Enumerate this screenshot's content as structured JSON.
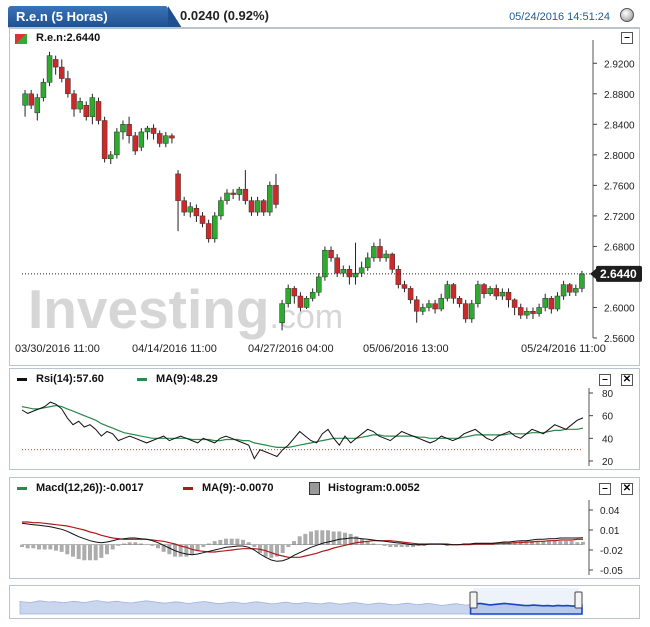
{
  "header": {
    "symbol": "R.e.n (5 Horas)",
    "change": "0.0240 (0.92%)",
    "datetime": "05/24/2016 14:51:24"
  },
  "price_panel": {
    "label": "R.e.n:2.6440",
    "last_value": "2.6440",
    "watermark": "Investing",
    "watermark_suffix": ".com"
  },
  "rsi_panel": {
    "rsi_label": "Rsi(14):57.60",
    "ma_label": "MA(9):48.29"
  },
  "macd_panel": {
    "macd_label": "Macd(12,26)):-0.0017",
    "signal_label": "MA(9):-0.0070",
    "hist_label": "Histogram:0.0052"
  },
  "colors": {
    "up": "#2eaa2e",
    "down": "#cc2a2a",
    "rsi": "#111111",
    "ma": "#2a8a4a",
    "macd_signal": "#b01818",
    "nav_fill": "#b8c9ea",
    "nav_line": "#1a44c8"
  },
  "chart_data": [
    {
      "type": "candlestick",
      "title": "R.e.n (5 Horas)",
      "ylim": [
        2.56,
        2.94
      ],
      "y_ticks": [
        "2.9200",
        "2.8800",
        "2.8400",
        "2.8000",
        "2.7600",
        "2.7200",
        "2.6800",
        "2.6400",
        "2.6000",
        "2.5600"
      ],
      "x_ticks": [
        "03/30/2016 11:00",
        "04/14/2016 11:00",
        "04/27/2016 04:00",
        "05/06/2016 13:00",
        "05/24/2016 11:00"
      ],
      "last": 2.644,
      "candles": [
        [
          2.865,
          2.88,
          2.85,
          2.885
        ],
        [
          2.88,
          2.865,
          2.86,
          2.885
        ],
        [
          2.855,
          2.875,
          2.845,
          2.88
        ],
        [
          2.875,
          2.895,
          2.87,
          2.9
        ],
        [
          2.895,
          2.93,
          2.89,
          2.935
        ],
        [
          2.925,
          2.915,
          2.905,
          2.93
        ],
        [
          2.915,
          2.9,
          2.895,
          2.925
        ],
        [
          2.9,
          2.88,
          2.875,
          2.91
        ],
        [
          2.88,
          2.86,
          2.85,
          2.885
        ],
        [
          2.86,
          2.87,
          2.855,
          2.875
        ],
        [
          2.865,
          2.85,
          2.845,
          2.87
        ],
        [
          2.85,
          2.875,
          2.84,
          2.88
        ],
        [
          2.87,
          2.845,
          2.84,
          2.875
        ],
        [
          2.845,
          2.795,
          2.79,
          2.85
        ],
        [
          2.795,
          2.8,
          2.788,
          2.805
        ],
        [
          2.8,
          2.83,
          2.795,
          2.835
        ],
        [
          2.83,
          2.84,
          2.82,
          2.845
        ],
        [
          2.84,
          2.825,
          2.815,
          2.85
        ],
        [
          2.825,
          2.805,
          2.8,
          2.83
        ],
        [
          2.81,
          2.83,
          2.805,
          2.835
        ],
        [
          2.83,
          2.835,
          2.82,
          2.838
        ],
        [
          2.835,
          2.828,
          2.82,
          2.84
        ],
        [
          2.828,
          2.815,
          2.81,
          2.832
        ],
        [
          2.815,
          2.825,
          2.81,
          2.83
        ],
        [
          2.825,
          2.822,
          2.815,
          2.828
        ],
        [
          2.775,
          2.74,
          2.7,
          2.78
        ],
        [
          2.74,
          2.725,
          2.72,
          2.745
        ],
        [
          2.725,
          2.732,
          2.718,
          2.738
        ],
        [
          2.73,
          2.72,
          2.712,
          2.735
        ],
        [
          2.72,
          2.71,
          2.705,
          2.725
        ],
        [
          2.71,
          2.69,
          2.685,
          2.715
        ],
        [
          2.69,
          2.72,
          2.685,
          2.725
        ],
        [
          2.72,
          2.74,
          2.715,
          2.745
        ],
        [
          2.74,
          2.75,
          2.735,
          2.755
        ],
        [
          2.75,
          2.748,
          2.742,
          2.755
        ],
        [
          2.748,
          2.755,
          2.74,
          2.758
        ],
        [
          2.755,
          2.74,
          2.735,
          2.78
        ],
        [
          2.74,
          2.725,
          2.72,
          2.745
        ],
        [
          2.725,
          2.74,
          2.72,
          2.745
        ],
        [
          2.74,
          2.725,
          2.72,
          2.742
        ],
        [
          2.725,
          2.76,
          2.72,
          2.765
        ],
        [
          2.76,
          2.735,
          2.73,
          2.775
        ],
        [
          2.58,
          2.605,
          2.57,
          2.61
        ],
        [
          2.605,
          2.625,
          2.6,
          2.63
        ],
        [
          2.625,
          2.615,
          2.605,
          2.628
        ],
        [
          2.615,
          2.6,
          2.595,
          2.62
        ],
        [
          2.6,
          2.612,
          2.598,
          2.615
        ],
        [
          2.612,
          2.62,
          2.608,
          2.625
        ],
        [
          2.62,
          2.64,
          2.615,
          2.645
        ],
        [
          2.64,
          2.675,
          2.635,
          2.68
        ],
        [
          2.675,
          2.665,
          2.66,
          2.68
        ],
        [
          2.665,
          2.645,
          2.64,
          2.67
        ],
        [
          2.645,
          2.65,
          2.64,
          2.655
        ],
        [
          2.65,
          2.64,
          2.63,
          2.655
        ],
        [
          2.64,
          2.645,
          2.63,
          2.685
        ],
        [
          2.645,
          2.652,
          2.64,
          2.66
        ],
        [
          2.652,
          2.665,
          2.648,
          2.672
        ],
        [
          2.665,
          2.68,
          2.66,
          2.685
        ],
        [
          2.68,
          2.665,
          2.66,
          2.69
        ],
        [
          2.665,
          2.67,
          2.66,
          2.675
        ],
        [
          2.67,
          2.65,
          2.645,
          2.672
        ],
        [
          2.65,
          2.63,
          2.625,
          2.655
        ],
        [
          2.63,
          2.625,
          2.62,
          2.635
        ],
        [
          2.625,
          2.61,
          2.605,
          2.628
        ],
        [
          2.61,
          2.595,
          2.58,
          2.615
        ],
        [
          2.595,
          2.6,
          2.59,
          2.605
        ],
        [
          2.6,
          2.605,
          2.595,
          2.61
        ],
        [
          2.605,
          2.598,
          2.592,
          2.61
        ],
        [
          2.598,
          2.612,
          2.595,
          2.618
        ],
        [
          2.612,
          2.63,
          2.608,
          2.635
        ],
        [
          2.63,
          2.612,
          2.605,
          2.632
        ],
        [
          2.612,
          2.605,
          2.6,
          2.615
        ],
        [
          2.605,
          2.585,
          2.58,
          2.61
        ],
        [
          2.585,
          2.605,
          2.58,
          2.61
        ],
        [
          2.605,
          2.63,
          2.6,
          2.635
        ],
        [
          2.63,
          2.618,
          2.612,
          2.632
        ],
        [
          2.618,
          2.625,
          2.615,
          2.628
        ],
        [
          2.625,
          2.615,
          2.61,
          2.63
        ],
        [
          2.615,
          2.62,
          2.61,
          2.625
        ],
        [
          2.62,
          2.61,
          2.6,
          2.625
        ],
        [
          2.61,
          2.6,
          2.59,
          2.612
        ],
        [
          2.6,
          2.59,
          2.585,
          2.605
        ],
        [
          2.59,
          2.595,
          2.585,
          2.6
        ],
        [
          2.595,
          2.592,
          2.585,
          2.6
        ],
        [
          2.592,
          2.6,
          2.588,
          2.605
        ],
        [
          2.6,
          2.612,
          2.595,
          2.618
        ],
        [
          2.612,
          2.598,
          2.592,
          2.615
        ],
        [
          2.598,
          2.615,
          2.595,
          2.62
        ],
        [
          2.615,
          2.63,
          2.61,
          2.635
        ],
        [
          2.63,
          2.62,
          2.615,
          2.632
        ],
        [
          2.62,
          2.625,
          2.615,
          2.63
        ],
        [
          2.625,
          2.644,
          2.62,
          2.648
        ]
      ]
    },
    {
      "type": "line",
      "ylim": [
        20,
        80
      ],
      "y_ticks": [
        "80",
        "60",
        "40",
        "20"
      ],
      "reference_line": 30,
      "series": [
        {
          "name": "Rsi(14)",
          "values": [
            65,
            62,
            64,
            66,
            68,
            72,
            70,
            66,
            58,
            52,
            55,
            50,
            52,
            48,
            42,
            46,
            44,
            38,
            40,
            42,
            40,
            38,
            36,
            38,
            40,
            42,
            38,
            40,
            42,
            40,
            38,
            36,
            40,
            38,
            36,
            40,
            42,
            40,
            38,
            36,
            34,
            22,
            30,
            28,
            26,
            24,
            30,
            34,
            40,
            46,
            42,
            38,
            36,
            44,
            48,
            40,
            34,
            42,
            36,
            40,
            44,
            48,
            46,
            42,
            40,
            38,
            42,
            46,
            44,
            42,
            40,
            38,
            36,
            38,
            42,
            40,
            38,
            40,
            44,
            46,
            48,
            44,
            40,
            38,
            42,
            44,
            46,
            42,
            40,
            44,
            48,
            46,
            44,
            48,
            52,
            50,
            48,
            52,
            56,
            58
          ]
        },
        {
          "name": "MA(9)",
          "values": [
            68,
            67,
            66,
            66,
            67,
            68,
            69,
            68,
            66,
            64,
            62,
            60,
            58,
            56,
            53,
            51,
            49,
            47,
            45,
            44,
            43,
            42,
            41,
            40,
            40,
            40,
            40,
            40,
            40,
            40,
            39,
            39,
            39,
            39,
            38,
            38,
            39,
            39,
            39,
            38,
            38,
            36,
            35,
            34,
            33,
            32,
            32,
            32,
            33,
            34,
            35,
            36,
            37,
            38,
            39,
            40,
            40,
            40,
            40,
            40,
            41,
            42,
            43,
            43,
            42,
            42,
            42,
            42,
            42,
            42,
            41,
            41,
            40,
            40,
            40,
            40,
            40,
            40,
            41,
            42,
            43,
            43,
            43,
            43,
            43,
            43,
            44,
            44,
            44,
            44,
            45,
            45,
            45,
            46,
            47,
            47,
            48,
            48,
            48,
            49
          ]
        }
      ]
    },
    {
      "type": "line",
      "ylim": [
        -0.05,
        0.04
      ],
      "y_ticks": [
        "0.04",
        "0.01",
        "-0.02",
        "-0.05"
      ],
      "series": [
        {
          "name": "Macd(12,26))",
          "values": [
            0.02,
            0.019,
            0.018,
            0.017,
            0.016,
            0.015,
            0.013,
            0.011,
            0.008,
            0.004,
            0.0,
            -0.003,
            -0.006,
            -0.008,
            -0.009,
            -0.008,
            -0.006,
            -0.004,
            -0.003,
            -0.002,
            -0.002,
            -0.003,
            -0.004,
            -0.006,
            -0.009,
            -0.013,
            -0.017,
            -0.021,
            -0.024,
            -0.026,
            -0.027,
            -0.026,
            -0.024,
            -0.022,
            -0.02,
            -0.018,
            -0.016,
            -0.015,
            -0.014,
            -0.014,
            -0.016,
            -0.02,
            -0.026,
            -0.031,
            -0.035,
            -0.037,
            -0.036,
            -0.033,
            -0.028,
            -0.024,
            -0.02,
            -0.016,
            -0.013,
            -0.01,
            -0.008,
            -0.006,
            -0.004,
            -0.003,
            -0.002,
            -0.002,
            -0.003,
            -0.004,
            -0.005,
            -0.006,
            -0.007,
            -0.008,
            -0.009,
            -0.01,
            -0.011,
            -0.012,
            -0.012,
            -0.012,
            -0.011,
            -0.011,
            -0.011,
            -0.012,
            -0.012,
            -0.012,
            -0.011,
            -0.011,
            -0.01,
            -0.01,
            -0.01,
            -0.01,
            -0.009,
            -0.008,
            -0.008,
            -0.007,
            -0.006,
            -0.006,
            -0.005,
            -0.004,
            -0.004,
            -0.003,
            -0.003,
            -0.002,
            -0.002,
            -0.002,
            -0.002,
            -0.0017
          ]
        },
        {
          "name": "MA(9)",
          "values": [
            0.022,
            0.022,
            0.021,
            0.021,
            0.02,
            0.019,
            0.018,
            0.017,
            0.016,
            0.014,
            0.012,
            0.01,
            0.007,
            0.005,
            0.002,
            0.0,
            -0.002,
            -0.003,
            -0.004,
            -0.004,
            -0.004,
            -0.004,
            -0.004,
            -0.005,
            -0.006,
            -0.007,
            -0.009,
            -0.011,
            -0.014,
            -0.016,
            -0.019,
            -0.021,
            -0.022,
            -0.023,
            -0.023,
            -0.022,
            -0.021,
            -0.02,
            -0.019,
            -0.018,
            -0.018,
            -0.018,
            -0.019,
            -0.021,
            -0.024,
            -0.027,
            -0.029,
            -0.031,
            -0.031,
            -0.031,
            -0.029,
            -0.027,
            -0.025,
            -0.022,
            -0.02,
            -0.017,
            -0.015,
            -0.013,
            -0.011,
            -0.009,
            -0.008,
            -0.007,
            -0.006,
            -0.006,
            -0.006,
            -0.006,
            -0.007,
            -0.008,
            -0.009,
            -0.01,
            -0.011,
            -0.011,
            -0.011,
            -0.011,
            -0.011,
            -0.011,
            -0.012,
            -0.012,
            -0.012,
            -0.012,
            -0.011,
            -0.011,
            -0.011,
            -0.011,
            -0.01,
            -0.01,
            -0.01,
            -0.009,
            -0.009,
            -0.008,
            -0.008,
            -0.007,
            -0.007,
            -0.006,
            -0.006,
            -0.005,
            -0.005,
            -0.005,
            -0.004,
            -0.004
          ]
        }
      ]
    },
    {
      "type": "area",
      "values": [
        0.52,
        0.5,
        0.48,
        0.51,
        0.55,
        0.53,
        0.5,
        0.52,
        0.49,
        0.47,
        0.5,
        0.53,
        0.51,
        0.48,
        0.5,
        0.54,
        0.56,
        0.52,
        0.49,
        0.51,
        0.53,
        0.5,
        0.48,
        0.46,
        0.49,
        0.52,
        0.55,
        0.53,
        0.5,
        0.47,
        0.45,
        0.48,
        0.51,
        0.49,
        0.46,
        0.44,
        0.47,
        0.5,
        0.52,
        0.49,
        0.46,
        0.43,
        0.45,
        0.48,
        0.5,
        0.47,
        0.44,
        0.46,
        0.49,
        0.51,
        0.48,
        0.45,
        0.42,
        0.44,
        0.47,
        0.49,
        0.46,
        0.43,
        0.45,
        0.48,
        0.46,
        0.44,
        0.42,
        0.45,
        0.47,
        0.44,
        0.41,
        0.43,
        0.46,
        0.48,
        0.45,
        0.42,
        0.4,
        0.43,
        0.46,
        0.44,
        0.41,
        0.38,
        0.4,
        0.43,
        0.45,
        0.42,
        0.39,
        0.41,
        0.44,
        0.42,
        0.39,
        0.36,
        0.38,
        0.41,
        0.43,
        0.4,
        0.37,
        0.39,
        0.42,
        0.44,
        0.41,
        0.38,
        0.4,
        0.42,
        0.44,
        0.42,
        0.4,
        0.38,
        0.36,
        0.35,
        0.37,
        0.36,
        0.34,
        0.35,
        0.33,
        0.36,
        0.34,
        0.35,
        0.33,
        0.34,
        0.36
      ]
    }
  ]
}
